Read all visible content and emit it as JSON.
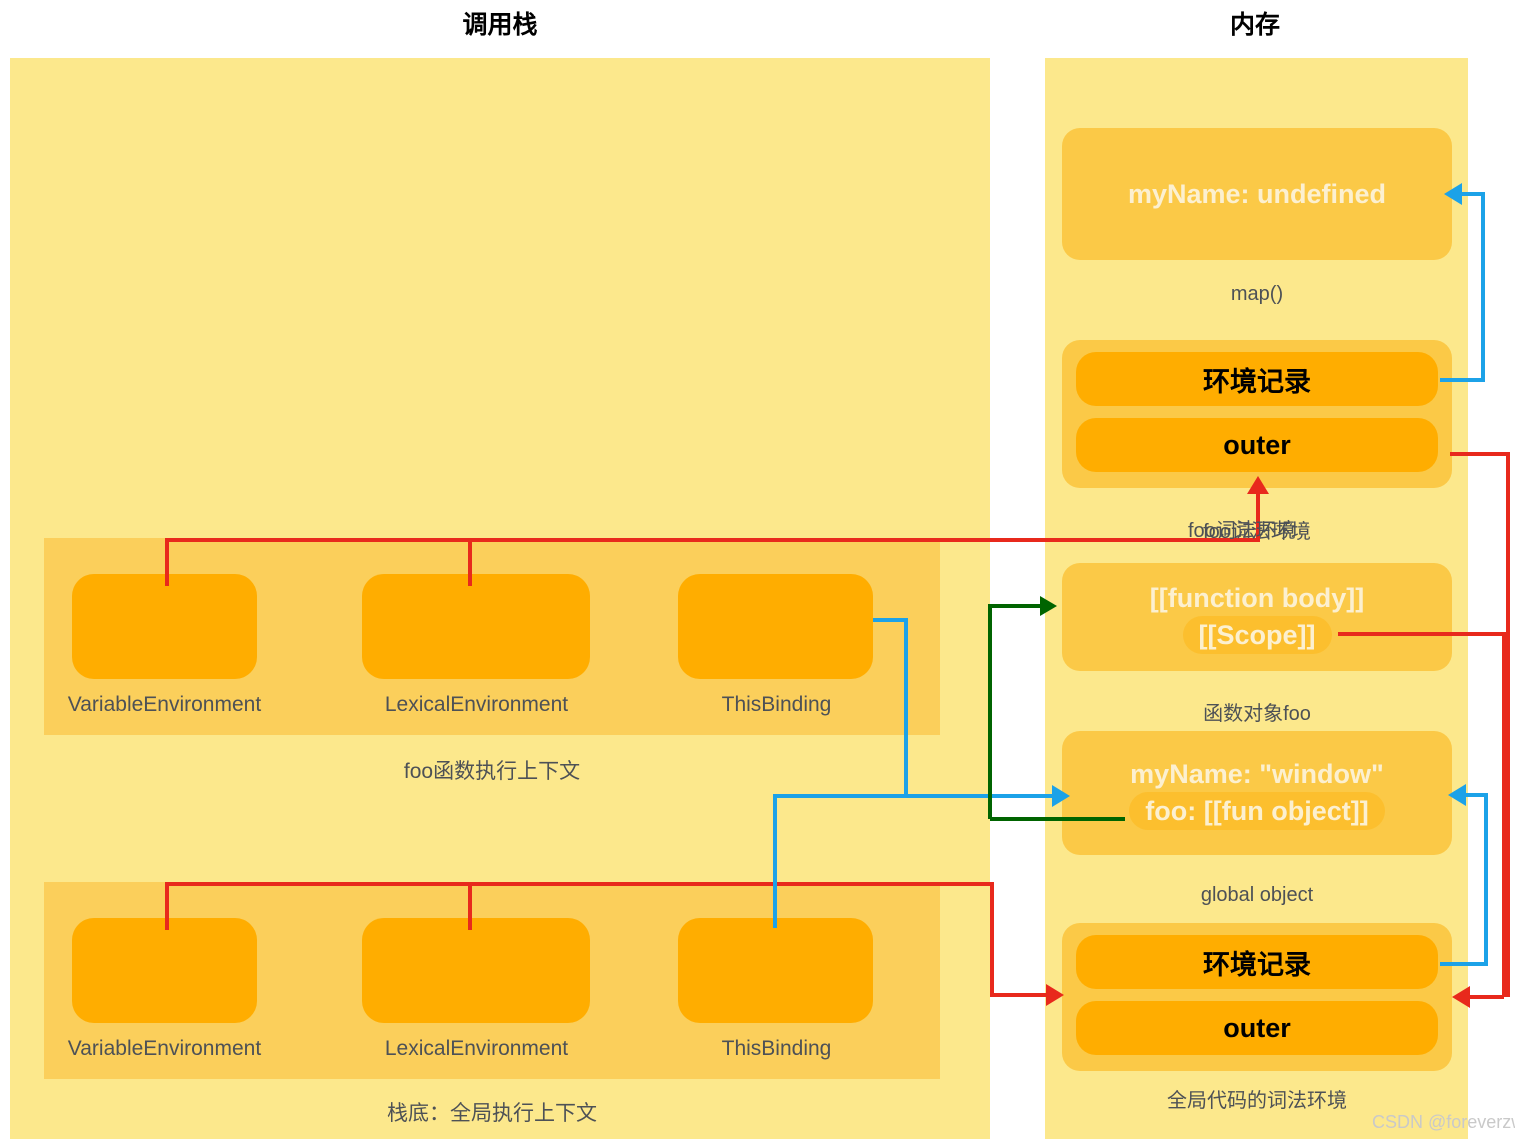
{
  "columns": {
    "call_stack_title": "调用栈",
    "memory_title": "内存"
  },
  "call_stack": {
    "contexts": [
      {
        "caption": "foo函数执行上下文",
        "slots": [
          "VariableEnvironment",
          "LexicalEnvironment",
          "ThisBinding"
        ]
      },
      {
        "caption": "栈底：全局执行上下文",
        "slots": [
          "VariableEnvironment",
          "LexicalEnvironment",
          "ThisBinding"
        ]
      }
    ]
  },
  "memory": {
    "cards": [
      {
        "lines": [
          "myName: undefined"
        ],
        "caption": "map()"
      },
      {
        "rows": [
          "环境记录",
          "outer"
        ],
        "caption": "foo词法环境"
      },
      {
        "lines": [
          "[[function body]]",
          "[[Scope]]"
        ],
        "caption": "函数对象foo"
      },
      {
        "lines": [
          "myName: \"window\"",
          "foo: [[fun object]]"
        ],
        "caption": "global object"
      },
      {
        "rows": [
          "环境记录",
          "outer"
        ],
        "caption": "全局代码的词法环境"
      }
    ]
  },
  "watermark": "CSDN @foreverzwl",
  "colors": {
    "panel_bg": "#FCE88C",
    "context_bg": "#FBCF5B",
    "card_bg": "#FBC947",
    "slot_orange": "#FFAD00",
    "pill": "#FCBF2E",
    "red": "#E8291C",
    "blue": "#1CA2E8",
    "green": "#006400",
    "caption_text": "#4D5156",
    "card_text": "#FCF0D0"
  }
}
